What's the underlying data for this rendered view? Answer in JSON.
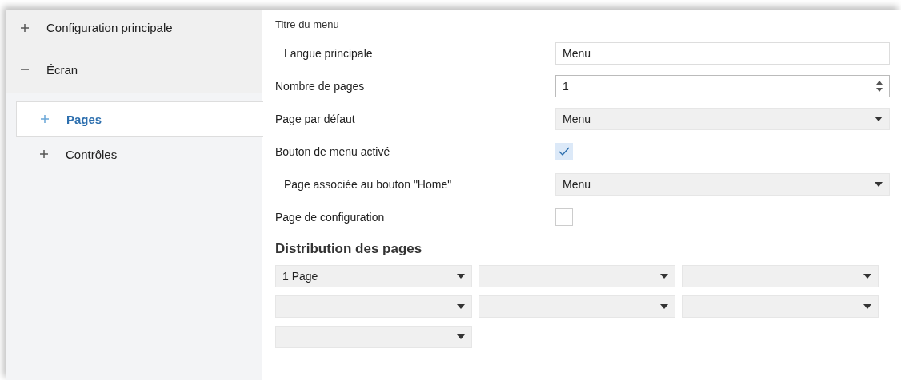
{
  "sidebar": {
    "items": [
      {
        "label": "Configuration principale",
        "expanded": false,
        "selected": false
      },
      {
        "label": "Écran",
        "expanded": true,
        "selected": false,
        "children": [
          {
            "label": "Pages",
            "expanded": false,
            "selected": true
          },
          {
            "label": "Contrôles",
            "expanded": false,
            "selected": false
          }
        ]
      }
    ]
  },
  "settings": {
    "section_title": "Titre du menu",
    "fields": [
      {
        "kind": "text",
        "label": "Langue principale",
        "indented": true,
        "value": "Menu"
      },
      {
        "kind": "spin",
        "label": "Nombre de pages",
        "indented": false,
        "value": "1"
      },
      {
        "kind": "dropdown",
        "label": "Page par défaut",
        "indented": false,
        "value": "Menu"
      },
      {
        "kind": "checkbox",
        "label": "Bouton de menu activé",
        "indented": false,
        "checked": true
      },
      {
        "kind": "dropdown",
        "label": "Page associée au bouton \"Home\"",
        "indented": true,
        "value": "Menu"
      },
      {
        "kind": "checkbox",
        "label": "Page de configuration",
        "indented": false,
        "checked": false
      }
    ]
  },
  "distribution": {
    "title": "Distribution des pages",
    "dropdowns": [
      {
        "kind": "dropdown",
        "value": "1 Page"
      },
      {
        "kind": "dropdown"
      },
      {
        "kind": "dropdown"
      },
      {
        "kind": "dropdown"
      },
      {
        "kind": "dropdown"
      },
      {
        "kind": "dropdown"
      },
      {
        "kind": "dropdown"
      }
    ]
  }
}
